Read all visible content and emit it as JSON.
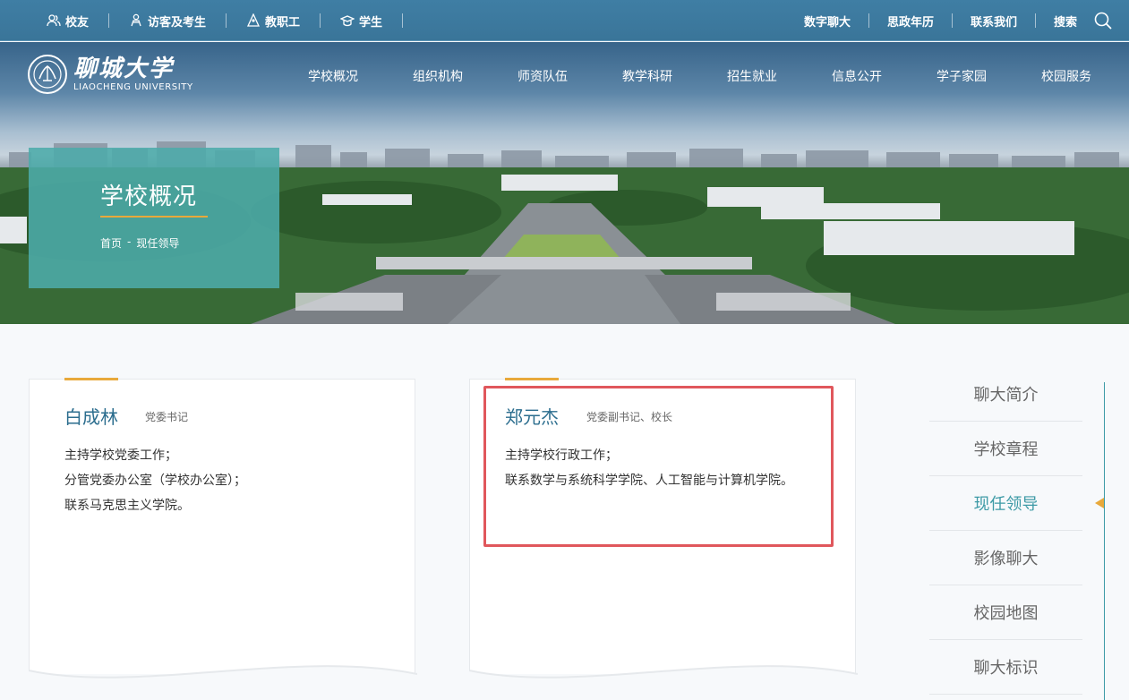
{
  "topbar": {
    "left": [
      {
        "label": "校友",
        "icon": "people-icon"
      },
      {
        "label": "访客及考生",
        "icon": "visitor-icon"
      },
      {
        "label": "教职工",
        "icon": "teacher-icon"
      },
      {
        "label": "学生",
        "icon": "graduation-cap-icon"
      }
    ],
    "right": [
      {
        "label": "数字聊大"
      },
      {
        "label": "思政年历"
      },
      {
        "label": "联系我们"
      },
      {
        "label": "搜索"
      }
    ]
  },
  "logo": {
    "cn": "聊城大学",
    "en": "LIAOCHENG UNIVERSITY"
  },
  "nav": [
    {
      "label": "学校概况"
    },
    {
      "label": "组织机构"
    },
    {
      "label": "师资队伍"
    },
    {
      "label": "教学科研"
    },
    {
      "label": "招生就业"
    },
    {
      "label": "信息公开"
    },
    {
      "label": "学子家园"
    },
    {
      "label": "校园服务"
    }
  ],
  "section": {
    "title": "学校概况",
    "breadcrumb": {
      "home": "首页",
      "sep": "-",
      "current": "现任领导"
    }
  },
  "leaders": [
    {
      "name": "白成林",
      "role": "党委书记",
      "duties": [
        "主持学校党委工作；",
        "分管党委办公室（学校办公室）；",
        "联系马克思主义学院。"
      ]
    },
    {
      "name": "郑元杰",
      "role": "党委副书记、校长",
      "duties": [
        "主持学校行政工作；",
        "联系数学与系统科学学院、人工智能与计算机学院。"
      ]
    }
  ],
  "sidebar": [
    {
      "label": "聊大简介"
    },
    {
      "label": "学校章程"
    },
    {
      "label": "现任领导",
      "active": true
    },
    {
      "label": "影像聊大"
    },
    {
      "label": "校园地图"
    },
    {
      "label": "聊大标识"
    }
  ],
  "colors": {
    "accent": "#e8a93b",
    "teal": "#3d9aa6",
    "topbar": "#3f7ea4",
    "highlight": "#e0575c"
  }
}
